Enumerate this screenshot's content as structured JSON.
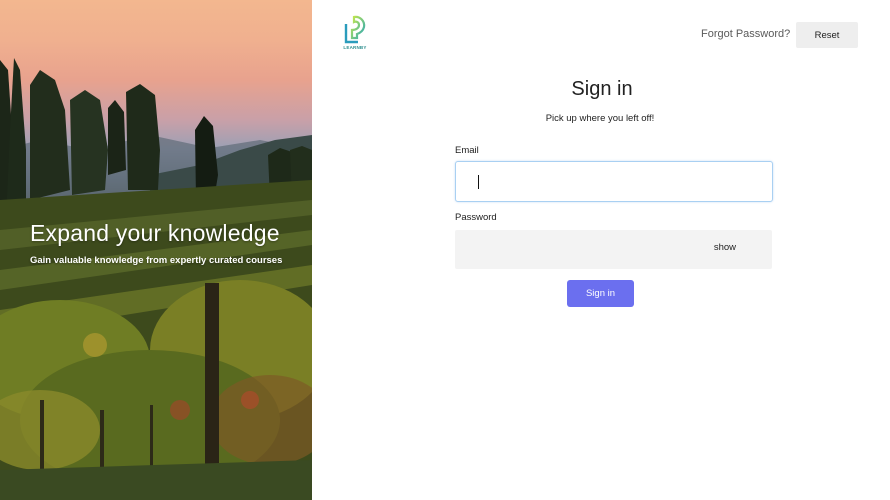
{
  "hero": {
    "title": "Expand your knowledge",
    "subtitle": "Gain valuable knowledge from expertly curated courses"
  },
  "brand": {
    "logo_text": "LEARNBY",
    "logo_icon": "learnby-logo-icon",
    "accent_color": "#6b6fef",
    "focus_color": "#a9d0f2"
  },
  "header": {
    "forgot_label": "Forgot Password?",
    "reset_label": "Reset"
  },
  "form": {
    "title": "Sign in",
    "subtitle": "Pick up where you left off!",
    "email_label": "Email",
    "email_value": "",
    "password_label": "Password",
    "password_value": "",
    "show_label": "show",
    "submit_label": "Sign in"
  }
}
